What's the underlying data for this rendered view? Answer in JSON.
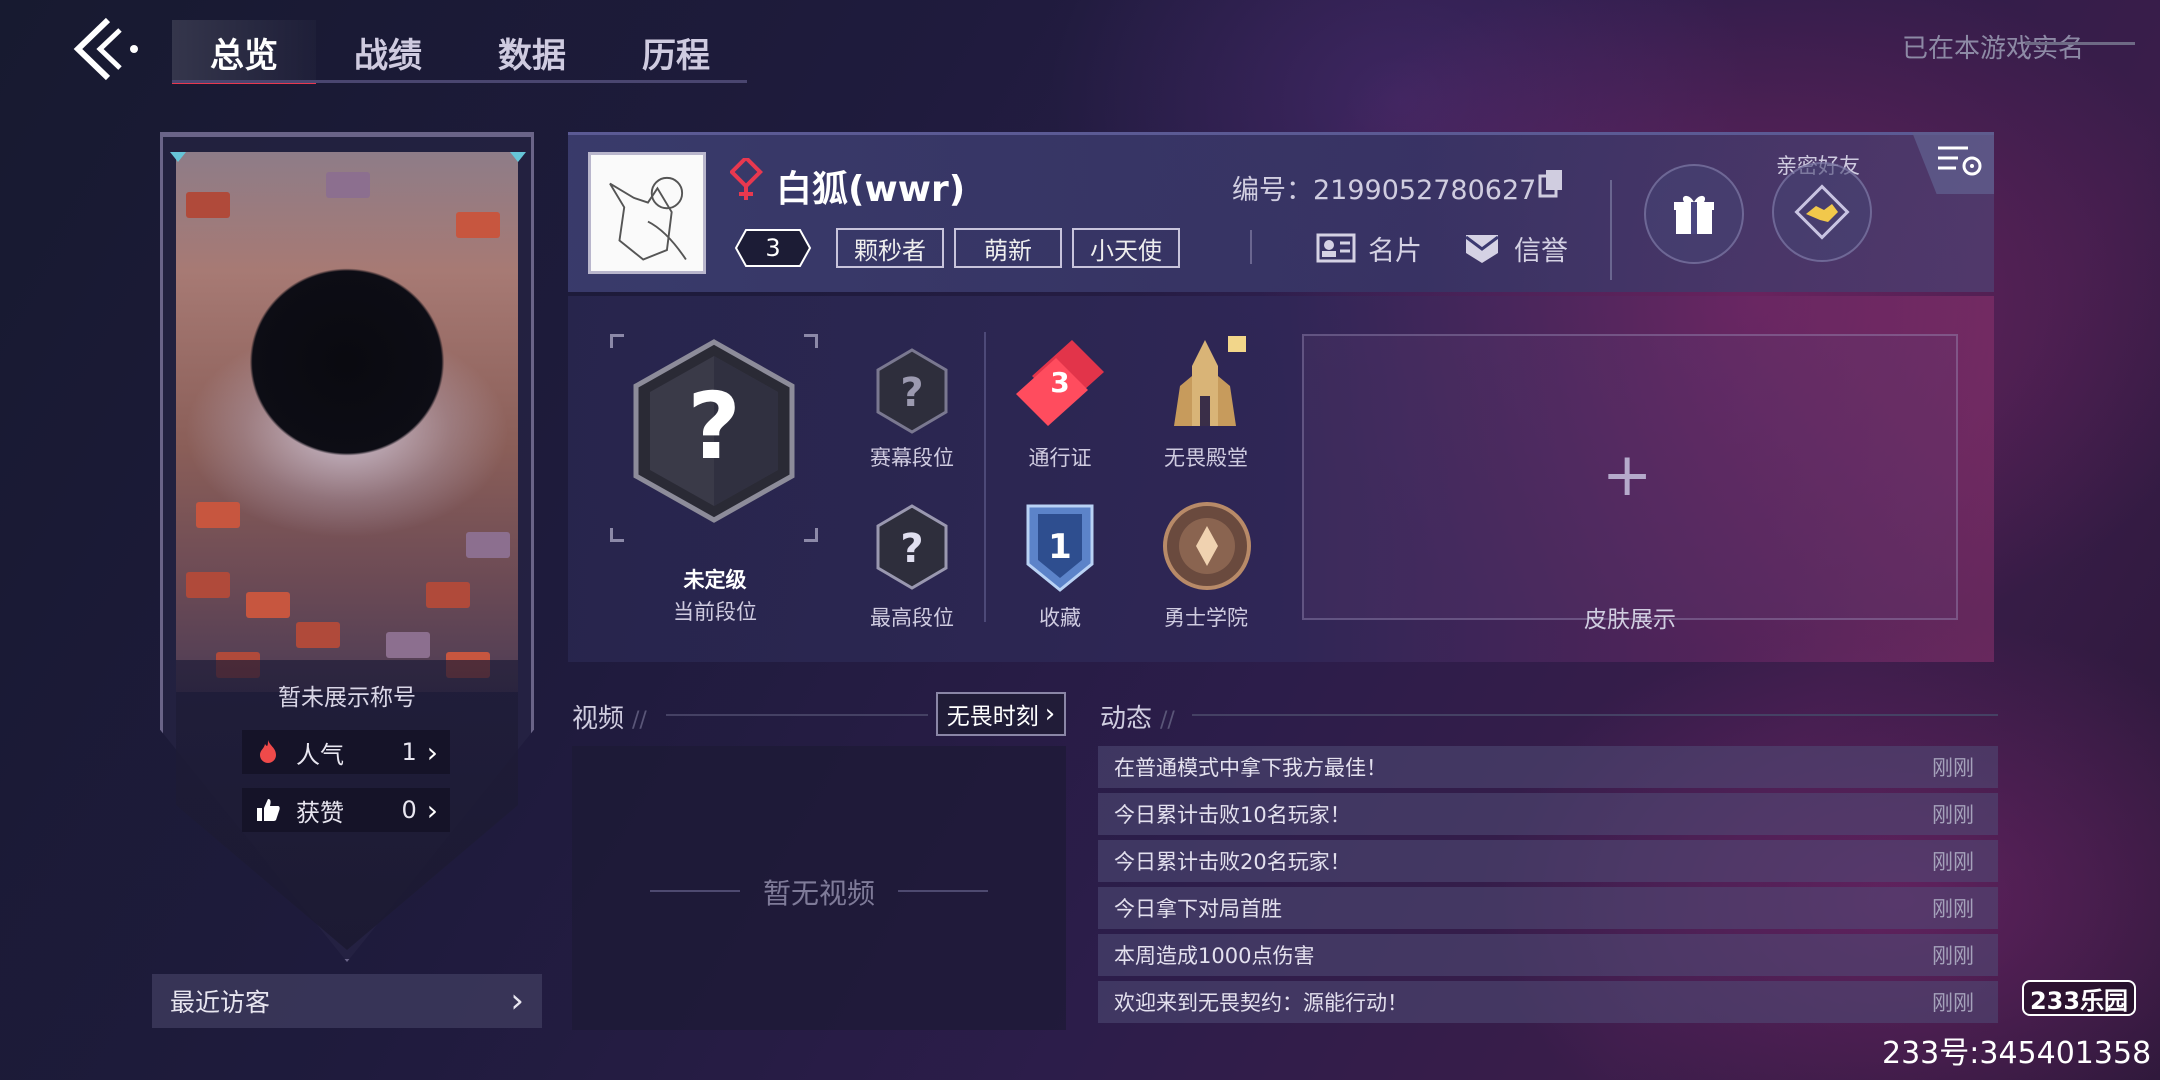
{
  "nav": {
    "tabs": [
      {
        "label": "总览",
        "active": true
      },
      {
        "label": "战绩",
        "active": false
      },
      {
        "label": "数据",
        "active": false
      },
      {
        "label": "历程",
        "active": false
      }
    ],
    "realname_status": "已在本游戏实名"
  },
  "left_card": {
    "title_placeholder": "暂未展示称号",
    "popularity": {
      "label": "人气",
      "value": "1"
    },
    "likes": {
      "label": "获赞",
      "value": "0"
    },
    "recent_visitors": "最近访客"
  },
  "profile": {
    "username": "白狐(wwr)",
    "level": "3",
    "tags": [
      "颗秒者",
      "萌新",
      "小天使"
    ],
    "player_id": "编号：2199052780627",
    "card_button": "名片",
    "credit_button": "信誉",
    "close_friend_label": "亲密好友",
    "accent_color": "#e8384f"
  },
  "ranks": {
    "current_rank": "未定级",
    "current_rank_label": "当前段位",
    "season_rank": "赛幕段位",
    "highest_rank": "最高段位",
    "battle_pass": "通行证",
    "battle_pass_level": "3",
    "hall": "无畏殿堂",
    "collection": "收藏",
    "collection_level": "1",
    "academy": "勇士学院",
    "skin_display": "皮肤展示"
  },
  "video": {
    "title": "视频",
    "fearless_button": "无畏时刻",
    "empty": "暂无视频"
  },
  "feed": {
    "title": "动态",
    "items": [
      {
        "text": "在普通模式中拿下我方最佳！",
        "time": "刚刚"
      },
      {
        "text": "今日累计击败10名玩家！",
        "time": "刚刚"
      },
      {
        "text": "今日累计击败20名玩家！",
        "time": "刚刚"
      },
      {
        "text": "今日拿下对局首胜",
        "time": "刚刚"
      },
      {
        "text": "本周造成1000点伤害",
        "time": "刚刚"
      },
      {
        "text": "欢迎来到无畏契约：源能行动！",
        "time": "刚刚"
      }
    ]
  },
  "watermark": {
    "logo": "233乐园",
    "id": "233号:345401358"
  }
}
